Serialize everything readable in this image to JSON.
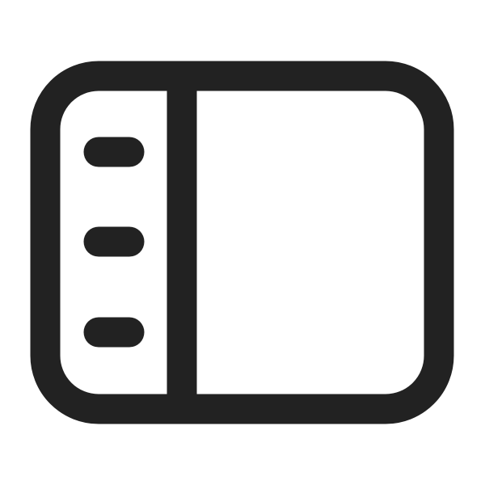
{
  "icon": {
    "name": "sidebar-panel-icon",
    "stroke_color": "#222222",
    "background_color": "#ffffff",
    "menu_lines": 3
  }
}
